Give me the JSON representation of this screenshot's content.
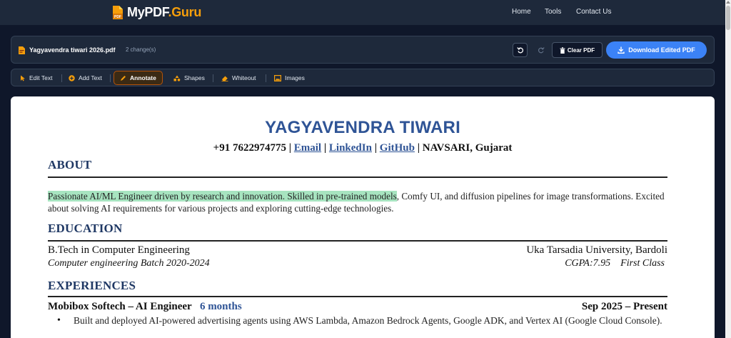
{
  "navbar": {
    "logo_text_white": "MyPDF",
    "logo_text_orange": ".Guru",
    "logo_icon_label": "PDF",
    "links": [
      "Home",
      "Tools",
      "Contact Us"
    ]
  },
  "file_bar": {
    "file_name": "Yagyavendra tiwari 2026.pdf",
    "changes": "2 change(s)",
    "clear_label": "Clear PDF",
    "download_label": "Download Edited PDF"
  },
  "toolbar": {
    "tools": [
      "Edit Text",
      "Add Text",
      "Annotate",
      "Shapes",
      "Whiteout",
      "Images"
    ],
    "active": "Annotate"
  },
  "document": {
    "name": "YAGYAVENDRA TIWARI",
    "contact": {
      "phone": "+91 7622974775",
      "email": "Email",
      "linkedin": "LinkedIn",
      "github": "GitHub",
      "location": "NAVSARI, Gujarat",
      "sep": "|"
    },
    "about_heading": "ABOUT",
    "about_highlighted": "Passionate AI/ML Engineer driven by research and innovation. Skilled in pre-trained models",
    "about_rest": ", Comfy UI, and diffusion pipelines for image transformations. Excited about solving AI requirements for various projects and exploring cutting-edge technologies.",
    "education_heading": "EDUCATION",
    "degree": "B.Tech in Computer Engineering",
    "university": "Uka Tarsadia University, Bardoli",
    "batch": "Computer engineering Batch 2020-2024",
    "cgpa": "CGPA:7.95",
    "class": "First Class",
    "experiences_heading": "EXPERIENCES",
    "job_title": "Mobibox Softech – AI Engineer",
    "job_duration": "6 months",
    "job_dates": "Sep 2025 – Present",
    "bullet_1": "Built and deployed AI-powered advertising agents using AWS Lambda, Amazon Bedrock Agents, Google ADK, and Vertex AI (Google Cloud Console)."
  },
  "colors": {
    "nav_bg": "#1e293b",
    "page_bg": "#0f172a",
    "accent_orange": "#f59e0b",
    "download_blue": "#3b82f6",
    "resume_blue": "#2f5496",
    "highlight_green": "#a7e4c0"
  }
}
